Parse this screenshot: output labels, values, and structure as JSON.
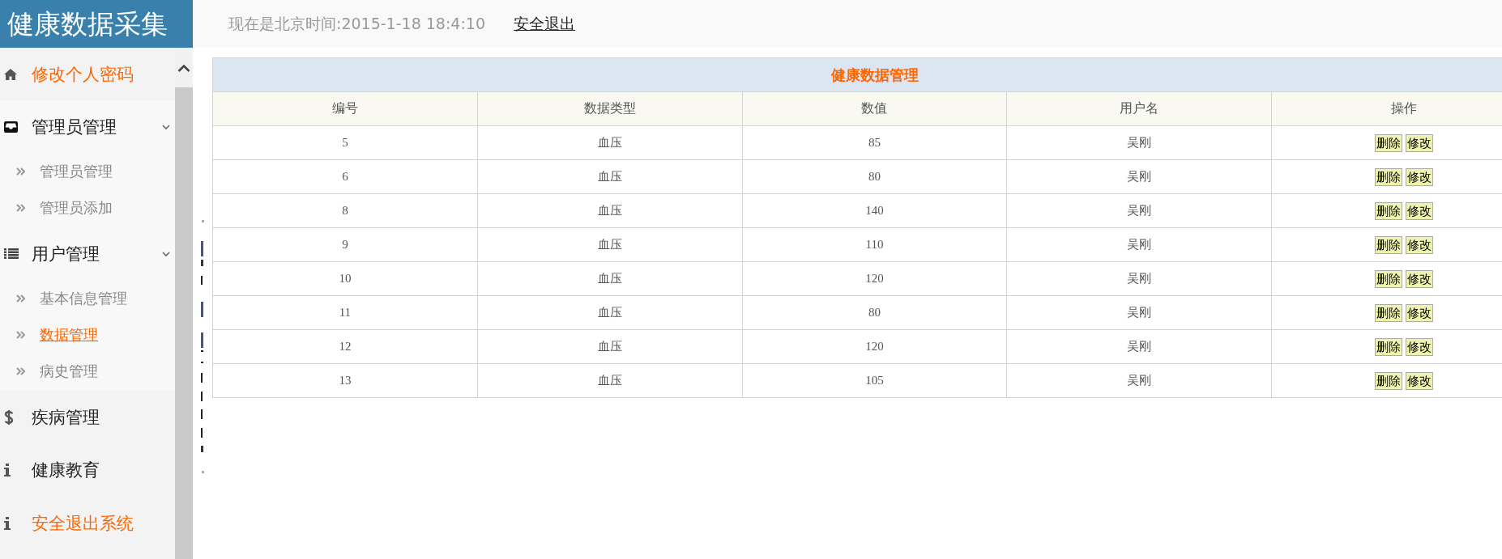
{
  "header": {
    "logo": "健康数据采集",
    "clock": "现在是北京时间:2015-1-18 18:4:10",
    "logout_link": "安全退出"
  },
  "sidebar": {
    "items": [
      {
        "label": "修改个人密码",
        "color": "#ff6600"
      },
      {
        "label": "管理员管理",
        "color": "#222222",
        "expanded": true,
        "children": [
          {
            "label": "管理员管理",
            "selected": false
          },
          {
            "label": "管理员添加",
            "selected": false
          }
        ]
      },
      {
        "label": "用户管理",
        "color": "#222222",
        "expanded": true,
        "children": [
          {
            "label": "基本信息管理",
            "selected": false
          },
          {
            "label": "数据管理",
            "selected": true
          },
          {
            "label": "病史管理",
            "selected": false
          }
        ]
      },
      {
        "label": "疾病管理",
        "color": "#222222"
      },
      {
        "label": "健康教育",
        "color": "#222222"
      },
      {
        "label": "安全退出系统",
        "color": "#ff6600"
      }
    ]
  },
  "table": {
    "title": "健康数据管理",
    "columns": [
      "编号",
      "数据类型",
      "数值",
      "用户名",
      "操作"
    ],
    "rows": [
      {
        "cells": [
          "5",
          "血压",
          "85",
          "吴刚"
        ],
        "actions": [
          "删除",
          "修改"
        ]
      },
      {
        "cells": [
          "6",
          "血压",
          "80",
          "吴刚"
        ],
        "actions": [
          "删除",
          "修改"
        ]
      },
      {
        "cells": [
          "8",
          "血压",
          "140",
          "吴刚"
        ],
        "actions": [
          "删除",
          "修改"
        ]
      },
      {
        "cells": [
          "9",
          "血压",
          "110",
          "吴刚"
        ],
        "actions": [
          "删除",
          "修改"
        ]
      },
      {
        "cells": [
          "10",
          "血压",
          "120",
          "吴刚"
        ],
        "actions": [
          "删除",
          "修改"
        ]
      },
      {
        "cells": [
          "11",
          "血压",
          "80",
          "吴刚"
        ],
        "actions": [
          "删除",
          "修改"
        ]
      },
      {
        "cells": [
          "12",
          "血压",
          "120",
          "吴刚"
        ],
        "actions": [
          "删除",
          "修改"
        ]
      },
      {
        "cells": [
          "13",
          "血压",
          "105",
          "吴刚"
        ],
        "actions": [
          "删除",
          "修改"
        ]
      }
    ]
  }
}
